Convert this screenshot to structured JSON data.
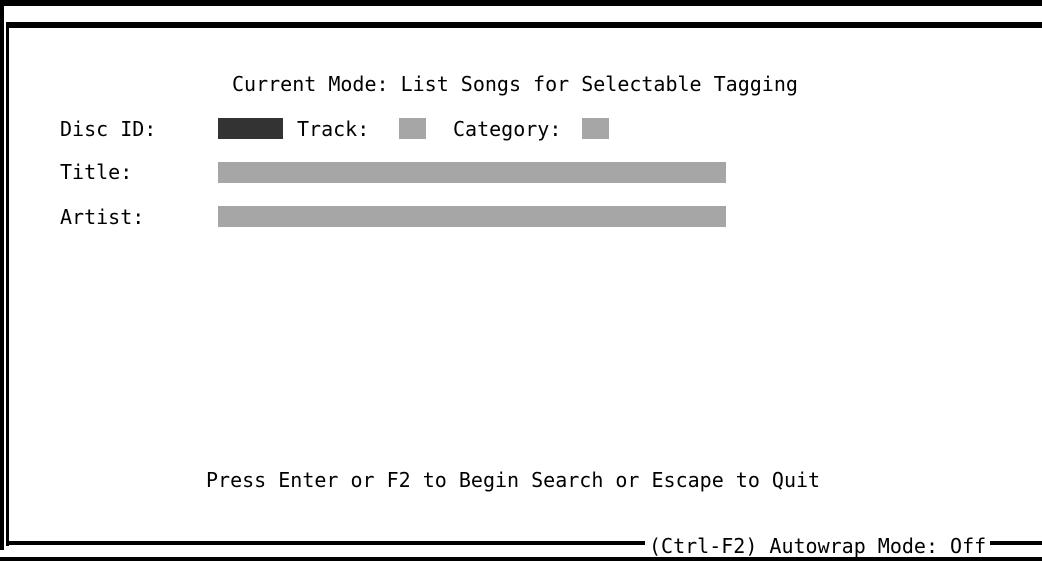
{
  "mode_line": "Current Mode: List Songs for Selectable Tagging",
  "fields": {
    "disc_id_label": "Disc ID:",
    "track_label": "Track:",
    "category_label": "Category:",
    "title_label": "Title:",
    "artist_label": "Artist:",
    "disc_id_value": "",
    "track_value": "",
    "category_value": "",
    "title_value": "",
    "artist_value": ""
  },
  "prompt": "Press Enter or F2 to Begin Search or Escape to Quit",
  "status_bar": {
    "autowrap": "(Ctrl-F2) Autowrap Mode: Off"
  },
  "colors": {
    "active_field": "#333333",
    "inactive_field": "#a6a6a6",
    "background": "#ffffff",
    "text": "#000000"
  }
}
